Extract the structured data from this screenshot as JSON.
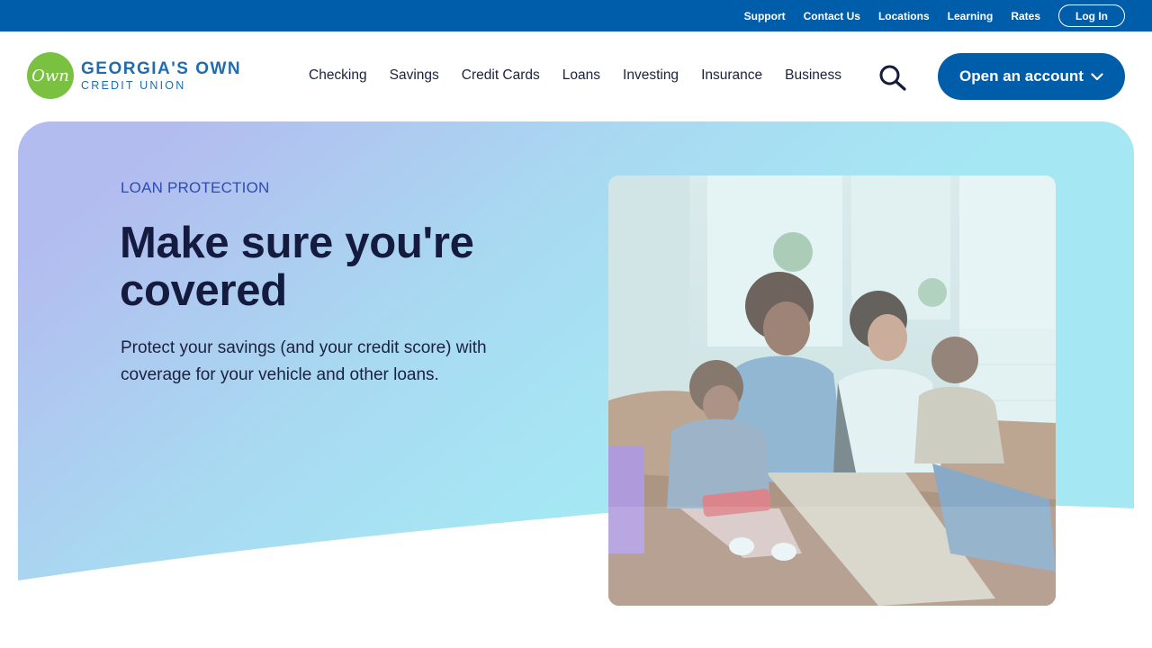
{
  "utility": {
    "links": [
      "Support",
      "Contact Us",
      "Locations",
      "Learning",
      "Rates"
    ],
    "login_label": "Log In"
  },
  "brand": {
    "badge": "Own",
    "name_line1": "GEORGIA'S OWN",
    "name_line2": "CREDIT UNION",
    "primary_color": "#005daa",
    "badge_color": "#7ac142"
  },
  "nav": {
    "items": [
      "Checking",
      "Savings",
      "Credit Cards",
      "Loans",
      "Investing",
      "Insurance",
      "Business"
    ],
    "search_icon": "search-icon",
    "cta_label": "Open an account",
    "cta_icon": "chevron-down-icon"
  },
  "hero": {
    "eyebrow": "LOAN PROTECTION",
    "headline": "Make sure you're covered",
    "subtext": "Protect your savings (and your credit score) with coverage for your vehicle and other loans.",
    "gradient_start": "#b3bcef",
    "gradient_end": "#a6e7f4"
  }
}
